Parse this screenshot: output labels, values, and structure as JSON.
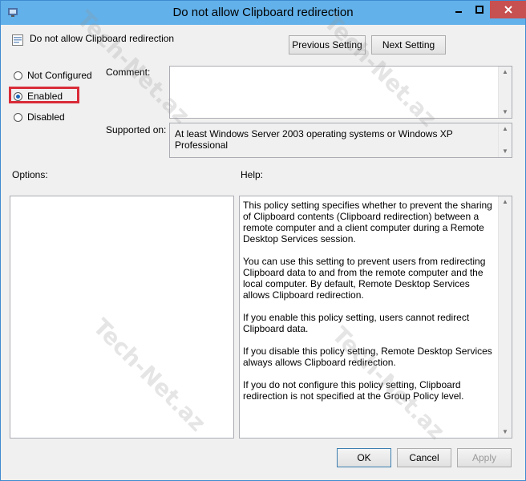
{
  "window": {
    "title": "Do not allow Clipboard redirection",
    "controls": {
      "minimize_icon": "minimize-icon",
      "maximize_icon": "maximize-icon",
      "close_icon": "close-icon"
    }
  },
  "header": {
    "policy_name": "Do not allow Clipboard redirection",
    "previous_label": "Previous Setting",
    "next_label": "Next Setting"
  },
  "state": {
    "options": [
      {
        "label": "Not Configured",
        "checked": false
      },
      {
        "label": "Enabled",
        "checked": true
      },
      {
        "label": "Disabled",
        "checked": false
      }
    ]
  },
  "comment": {
    "label": "Comment:",
    "value": ""
  },
  "supported": {
    "label": "Supported on:",
    "value": "At least Windows Server 2003 operating systems or Windows XP Professional"
  },
  "options_label": "Options:",
  "help": {
    "label": "Help:",
    "paragraphs": [
      "This policy setting specifies whether to prevent the sharing of Clipboard contents (Clipboard redirection) between a remote computer and a client computer during a Remote Desktop Services session.",
      "You can use this setting to prevent users from redirecting Clipboard data to and from the remote computer and the local computer. By default, Remote Desktop Services allows Clipboard redirection.",
      "If you enable this policy setting, users cannot redirect Clipboard data.",
      "If you disable this policy setting, Remote Desktop Services always allows Clipboard redirection.",
      "If you do not configure this policy setting, Clipboard redirection is not specified at the Group Policy level."
    ]
  },
  "footer": {
    "ok_label": "OK",
    "cancel_label": "Cancel",
    "apply_label": "Apply"
  },
  "watermark": {
    "text": "Tech-Net.az"
  },
  "colors": {
    "titlebar": "#62b1ea",
    "highlight": "#d92b38",
    "close": "#c75050"
  }
}
